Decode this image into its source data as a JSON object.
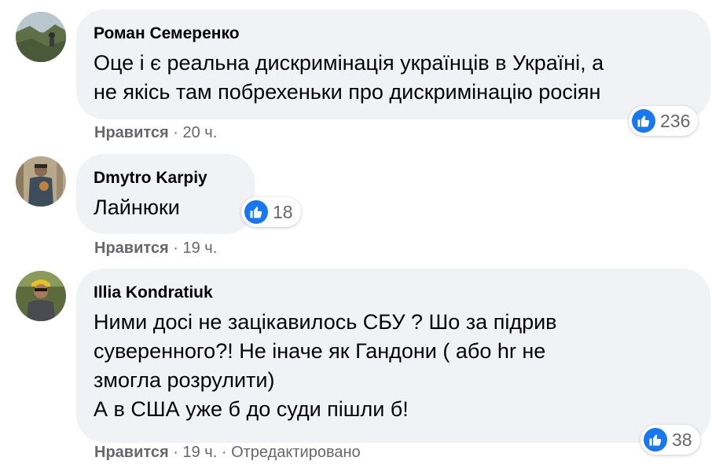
{
  "comments": [
    {
      "author": "Роман Семеренко",
      "text": "Оце і є реальна дискримінація українців в Україні, а\nне якісь там побрехеньки про дискримінацію росіян",
      "like_label": "Нравится",
      "time": "20 ч.",
      "reaction_icon": "like-icon",
      "reaction_count": "236"
    },
    {
      "author": "Dmytro Karpiy",
      "text": "Лайнюки",
      "like_label": "Нравится",
      "time": "19 ч.",
      "reaction_icon": "like-icon",
      "reaction_count": "18"
    },
    {
      "author": "Illia Kondratiuk",
      "text": "Ними досі не зацікавилось СБУ ? Шо за підрив\nсуверенного?! Не іначе як Гандони ( або hr не\nзмогла розрулити)\nА в США уже б до суди пішли б!",
      "like_label": "Нравится",
      "time": "19 ч.",
      "edited": "Отредактировано",
      "reaction_icon": "like-icon",
      "reaction_count": "38"
    }
  ],
  "separator": "·",
  "colors": {
    "bubble": "#f0f2f5",
    "like_blue": "#1877f2",
    "meta_gray": "#65676b"
  }
}
